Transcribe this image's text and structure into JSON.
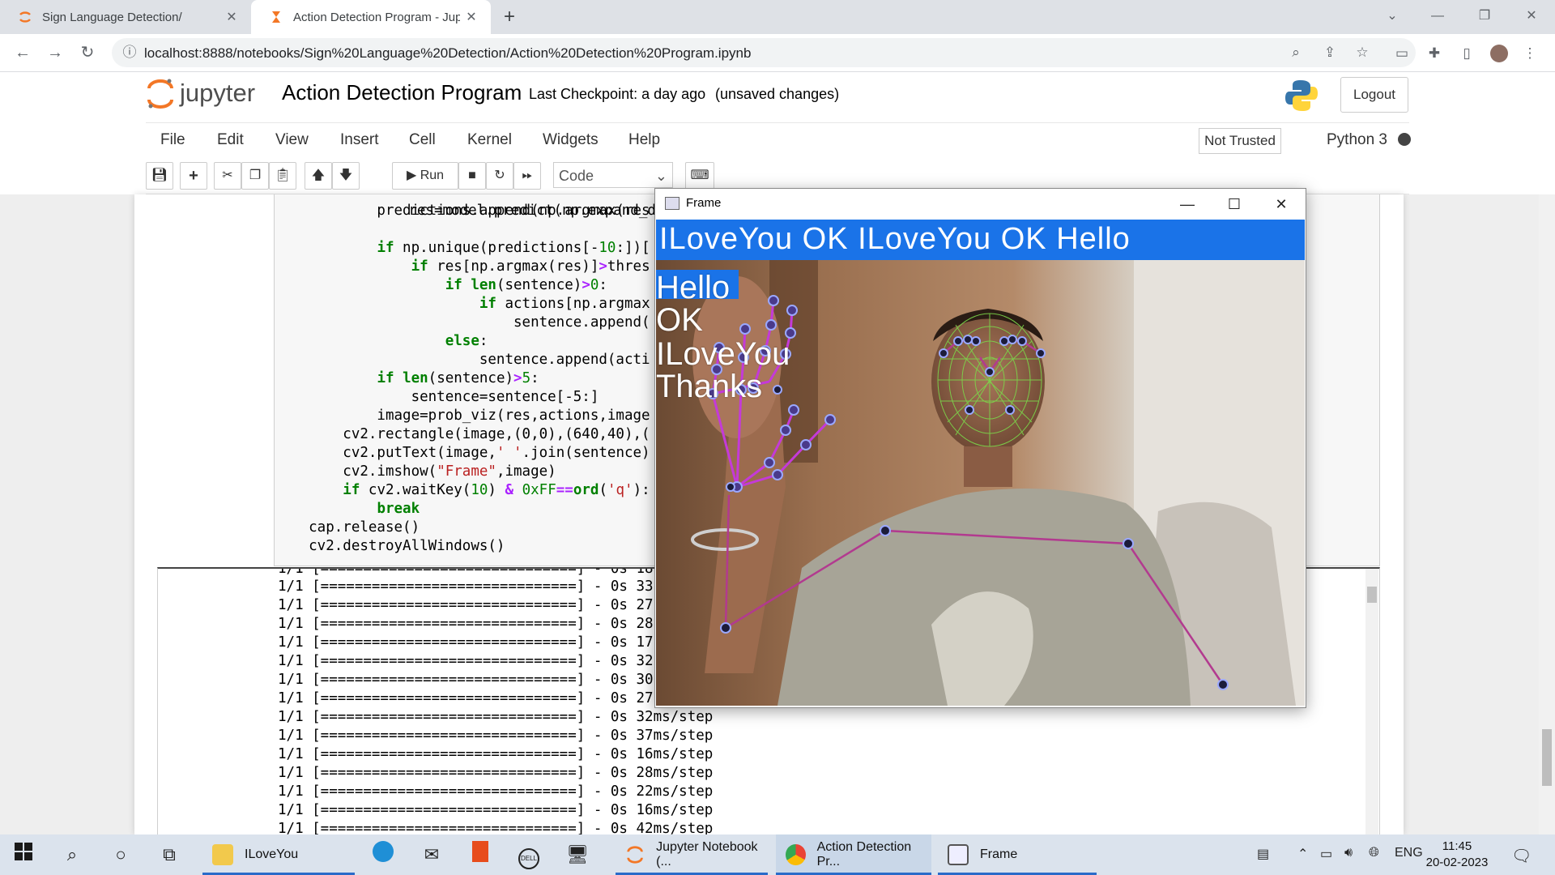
{
  "browser": {
    "tabs": [
      {
        "title": "Sign Language Detection/"
      },
      {
        "title": "Action Detection Program - Jupy"
      }
    ],
    "url": "localhost:8888/notebooks/Sign%20Language%20Detection/Action%20Detection%20Program.ipynb"
  },
  "jupyter": {
    "logo_text": "jupyter",
    "notebook_title": "Action Detection Program",
    "checkpoint": "Last Checkpoint: a day ago",
    "unsaved": "(unsaved changes)",
    "logout_label": "Logout",
    "menu": [
      "File",
      "Edit",
      "View",
      "Insert",
      "Cell",
      "Kernel",
      "Widgets",
      "Help"
    ],
    "trusted": "Not Trusted",
    "kernel": "Python 3",
    "run_label": "Run",
    "cell_type": "Code"
  },
  "code": [
    "            predictions.append(np.argmax(res",
    "",
    "            if np.unique(predictions[-10:])[",
    "                if res[np.argmax(res)]>thres",
    "                    if len(sentence)>0:",
    "                        if actions[np.argmax",
    "                            sentence.append(",
    "                    else:",
    "                        sentence.append(acti",
    "            if len(sentence)>5:",
    "                sentence=sentence[-5:]",
    "            image=prob_viz(res,actions,image",
    "        cv2.rectangle(image,(0,0),(640,40),(",
    "        cv2.putText(image,' '.join(sentence)",
    "        cv2.imshow(\"Frame\",image)",
    "        if cv2.waitKey(10) & 0xFF==ord('q'):",
    "            break",
    "    cap.release()",
    "    cv2.destroyAllWindows()"
  ],
  "output_lines": [
    "1/1 [==============================] - 0s 33",
    "1/1 [==============================] - 0s 27",
    "1/1 [==============================] - 0s 28",
    "1/1 [==============================] - 0s 17",
    "1/1 [==============================] - 0s 32",
    "1/1 [==============================] - 0s 30",
    "1/1 [==============================] - 0s 27",
    "1/1 [==============================] - 0s 32ms/step",
    "1/1 [==============================] - 0s 37ms/step",
    "1/1 [==============================] - 0s 16ms/step",
    "1/1 [==============================] - 0s 28ms/step",
    "1/1 [==============================] - 0s 22ms/step",
    "1/1 [==============================] - 0s 16ms/step",
    "1/1 [==============================] - 0s 42ms/step"
  ],
  "frame_window": {
    "title": "Frame",
    "sentence": "ILoveYou  OK  ILoveYou  OK  Hello",
    "probabilities": [
      {
        "label": "Hello",
        "value": 0.85,
        "color": "#1a73e8"
      },
      {
        "label": "OK",
        "value": 0.0,
        "color": "#f57c00"
      },
      {
        "label": "ILoveYou",
        "value": 0.0,
        "color": "#10b010"
      },
      {
        "label": "Thanks",
        "value": 0.0,
        "color": "#9c27b0"
      }
    ]
  },
  "taskbar": {
    "apps": [
      {
        "label": "ILoveYou"
      },
      {
        "label": "Jupyter Notebook (..."
      },
      {
        "label": "Action Detection Pr..."
      },
      {
        "label": "Frame"
      }
    ],
    "language": "ENG",
    "time": "11:45",
    "date": "20-02-2023"
  },
  "colors": {
    "accent": "#1a73e8",
    "jupyter_orange": "#f37726"
  }
}
